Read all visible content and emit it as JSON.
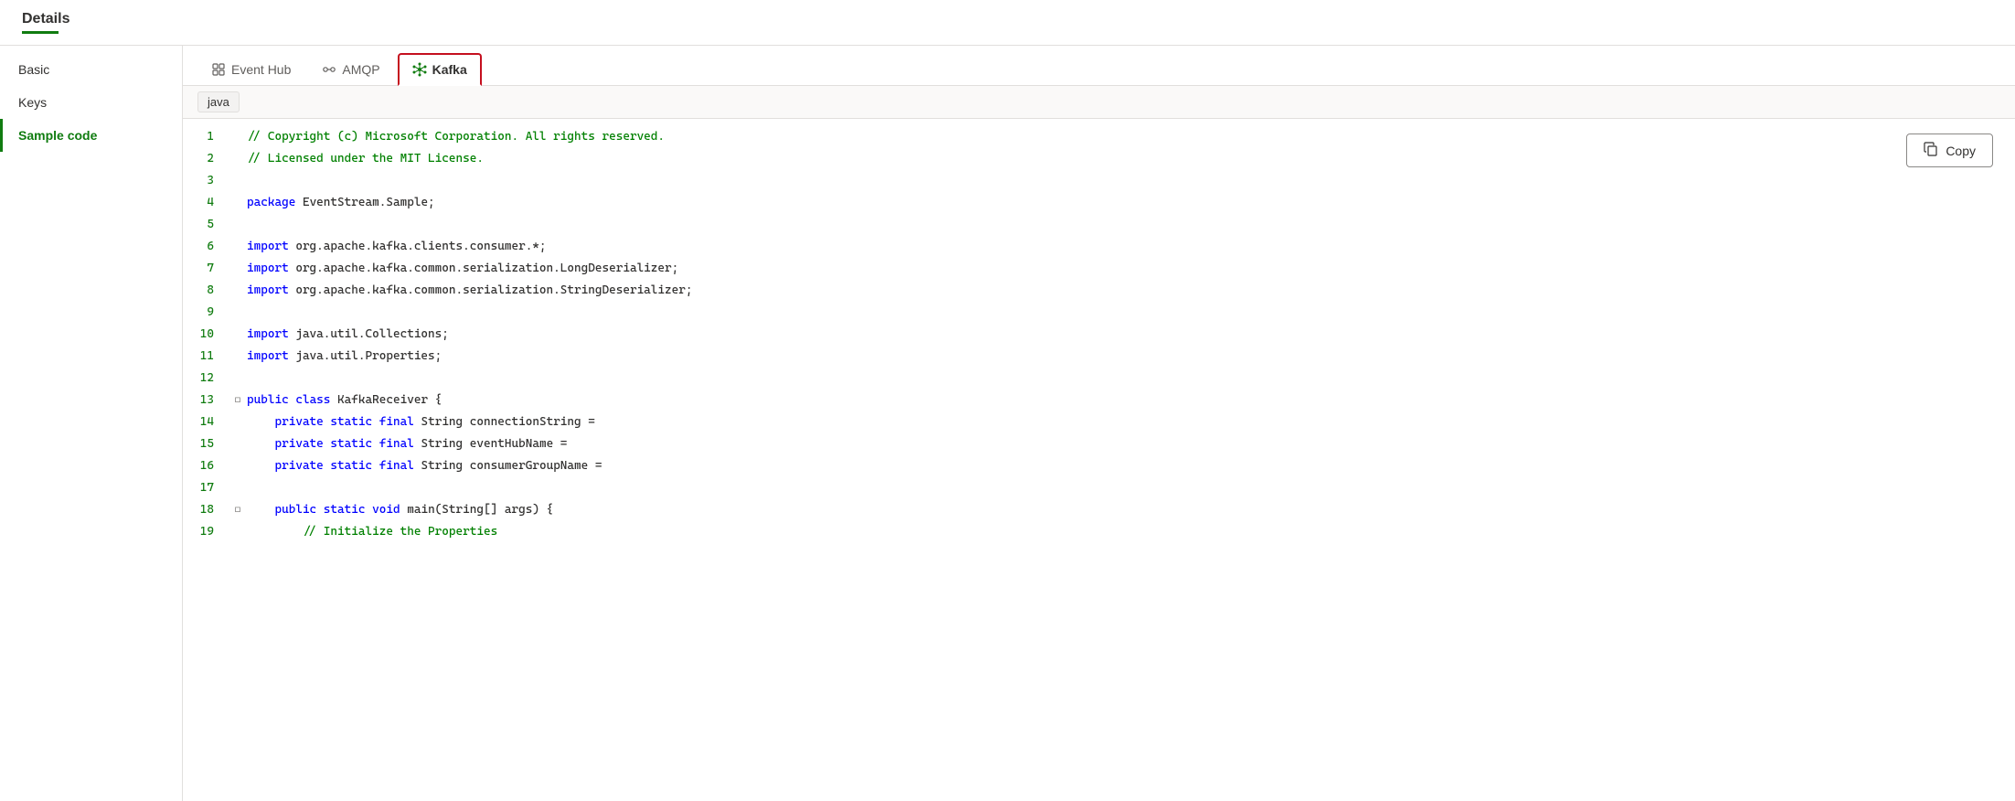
{
  "title": "Details",
  "sidebar": {
    "items": [
      {
        "id": "basic",
        "label": "Basic",
        "active": false
      },
      {
        "id": "keys",
        "label": "Keys",
        "active": false
      },
      {
        "id": "sample-code",
        "label": "Sample code",
        "active": true
      }
    ]
  },
  "tabs": [
    {
      "id": "event-hub",
      "label": "Event Hub",
      "icon": "grid-icon",
      "active": false
    },
    {
      "id": "amqp",
      "label": "AMQP",
      "icon": "connection-icon",
      "active": false
    },
    {
      "id": "kafka",
      "label": "Kafka",
      "icon": "kafka-icon",
      "active": true
    }
  ],
  "language": "java",
  "copy_button": "Copy",
  "code_lines": [
    {
      "num": "1",
      "indent": 0,
      "fold": false,
      "tokens": [
        {
          "text": "// Copyright (c) Microsoft Corporation. All rights reserved.",
          "class": "kw-comment"
        }
      ]
    },
    {
      "num": "2",
      "indent": 0,
      "fold": false,
      "tokens": [
        {
          "text": "// Licensed under the MIT License.",
          "class": "kw-comment"
        }
      ]
    },
    {
      "num": "3",
      "indent": 0,
      "fold": false,
      "tokens": []
    },
    {
      "num": "4",
      "indent": 0,
      "fold": false,
      "tokens": [
        {
          "text": "package",
          "class": "kw-blue"
        },
        {
          "text": " EventStream.Sample;",
          "class": ""
        }
      ]
    },
    {
      "num": "5",
      "indent": 0,
      "fold": false,
      "tokens": []
    },
    {
      "num": "6",
      "indent": 0,
      "fold": false,
      "tokens": [
        {
          "text": "import",
          "class": "kw-blue"
        },
        {
          "text": " org.apache.kafka.clients.consumer.*;",
          "class": ""
        }
      ]
    },
    {
      "num": "7",
      "indent": 0,
      "fold": false,
      "tokens": [
        {
          "text": "import",
          "class": "kw-blue"
        },
        {
          "text": " org.apache.kafka.common.serialization.LongDeserializer;",
          "class": ""
        }
      ]
    },
    {
      "num": "8",
      "indent": 0,
      "fold": false,
      "tokens": [
        {
          "text": "import",
          "class": "kw-blue"
        },
        {
          "text": " org.apache.kafka.common.serialization.StringDeserializer;",
          "class": ""
        }
      ]
    },
    {
      "num": "9",
      "indent": 0,
      "fold": false,
      "tokens": []
    },
    {
      "num": "10",
      "indent": 0,
      "fold": false,
      "tokens": [
        {
          "text": "import",
          "class": "kw-blue"
        },
        {
          "text": " java.util.Collections;",
          "class": ""
        }
      ]
    },
    {
      "num": "11",
      "indent": 0,
      "fold": false,
      "tokens": [
        {
          "text": "import",
          "class": "kw-blue"
        },
        {
          "text": " java.util.Properties;",
          "class": ""
        }
      ]
    },
    {
      "num": "12",
      "indent": 0,
      "fold": false,
      "tokens": []
    },
    {
      "num": "13",
      "indent": 0,
      "fold": true,
      "tokens": [
        {
          "text": "public",
          "class": "kw-blue"
        },
        {
          "text": " ",
          "class": ""
        },
        {
          "text": "class",
          "class": "kw-blue"
        },
        {
          "text": " KafkaReceiver {",
          "class": ""
        }
      ]
    },
    {
      "num": "14",
      "indent": 1,
      "fold": false,
      "tokens": [
        {
          "text": "    private",
          "class": "kw-blue"
        },
        {
          "text": " ",
          "class": ""
        },
        {
          "text": "static",
          "class": "kw-blue"
        },
        {
          "text": " ",
          "class": ""
        },
        {
          "text": "final",
          "class": "kw-blue"
        },
        {
          "text": " String connectionString =",
          "class": ""
        }
      ]
    },
    {
      "num": "15",
      "indent": 1,
      "fold": false,
      "tokens": [
        {
          "text": "    private",
          "class": "kw-blue"
        },
        {
          "text": " ",
          "class": ""
        },
        {
          "text": "static",
          "class": "kw-blue"
        },
        {
          "text": " ",
          "class": ""
        },
        {
          "text": "final",
          "class": "kw-blue"
        },
        {
          "text": " String eventHubName =",
          "class": ""
        }
      ]
    },
    {
      "num": "16",
      "indent": 1,
      "fold": false,
      "tokens": [
        {
          "text": "    private",
          "class": "kw-blue"
        },
        {
          "text": " ",
          "class": ""
        },
        {
          "text": "static",
          "class": "kw-blue"
        },
        {
          "text": " ",
          "class": ""
        },
        {
          "text": "final",
          "class": "kw-blue"
        },
        {
          "text": " String consumerGroupName =",
          "class": ""
        }
      ]
    },
    {
      "num": "17",
      "indent": 0,
      "fold": false,
      "tokens": []
    },
    {
      "num": "18",
      "indent": 1,
      "fold": true,
      "tokens": [
        {
          "text": "    public",
          "class": "kw-blue"
        },
        {
          "text": " ",
          "class": ""
        },
        {
          "text": "static",
          "class": "kw-blue"
        },
        {
          "text": " ",
          "class": ""
        },
        {
          "text": "void",
          "class": "kw-blue"
        },
        {
          "text": " main(String[] args) {",
          "class": ""
        }
      ]
    },
    {
      "num": "19",
      "indent": 2,
      "fold": false,
      "tokens": [
        {
          "text": "        // Initialize the Properties",
          "class": "kw-comment"
        }
      ]
    }
  ]
}
